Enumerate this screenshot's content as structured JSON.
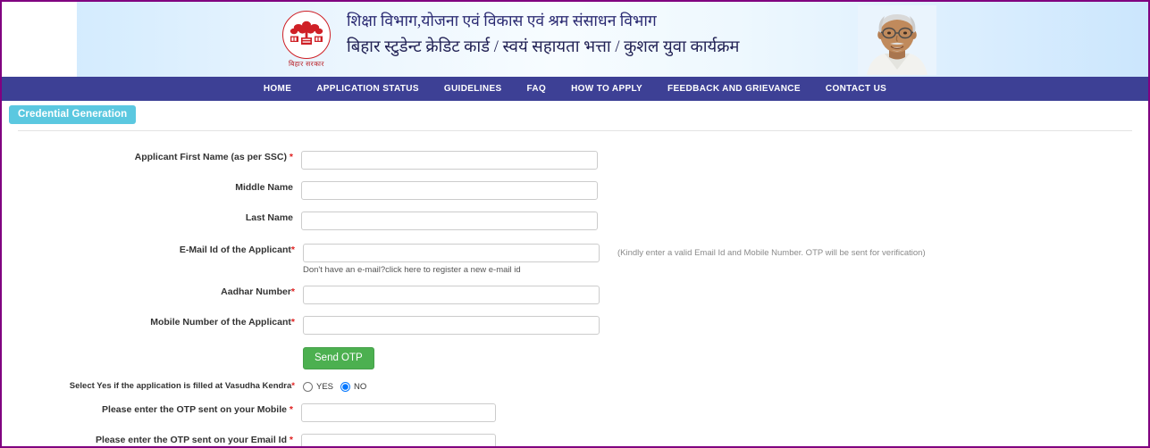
{
  "header": {
    "emblem_name": "bihar-government-emblem",
    "emblem_caption": "बिहार सरकार",
    "title_line1": "शिक्षा विभाग,योजना एवं विकास एवं श्रम संसाधन विभाग",
    "title_line2": "बिहार स्टुडेन्ट क्रेडिट कार्ड / स्वयं सहायता भत्ता / कुशल युवा कार्यक्रम",
    "portrait_name": "chief-minister-portrait"
  },
  "nav": {
    "items": [
      {
        "label": "HOME"
      },
      {
        "label": "APPLICATION STATUS"
      },
      {
        "label": "GUIDELINES"
      },
      {
        "label": "FAQ"
      },
      {
        "label": "HOW TO APPLY"
      },
      {
        "label": "FEEDBACK AND GRIEVANCE"
      },
      {
        "label": "CONTACT US"
      }
    ]
  },
  "tab": {
    "active_label": "Credential Generation"
  },
  "form": {
    "first_name": {
      "label": "Applicant First Name (as per SSC)",
      "required": true,
      "value": "",
      "placeholder": ""
    },
    "middle_name": {
      "label": "Middle Name",
      "required": false,
      "value": "",
      "placeholder": ""
    },
    "last_name": {
      "label": "Last Name",
      "required": false,
      "value": "",
      "placeholder": ""
    },
    "email": {
      "label": "E-Mail Id of the Applicant",
      "required": true,
      "value": "",
      "placeholder": "",
      "hint": "Don't have an e-mail?click here to register a new e-mail id",
      "side_note": "(Kindly enter a valid Email Id and Mobile Number. OTP will be sent for verification)"
    },
    "aadhar": {
      "label": "Aadhar Number",
      "required": true,
      "value": "",
      "placeholder": ""
    },
    "mobile": {
      "label": "Mobile Number of the Applicant",
      "required": true,
      "value": "",
      "placeholder": ""
    },
    "send_otp_button": "Send OTP",
    "vasudha": {
      "label": "Select Yes if the application is filled at Vasudha Kendra",
      "required": true,
      "option_yes": "YES",
      "option_no": "NO",
      "selected": "NO"
    },
    "otp_mobile": {
      "label": "Please enter the OTP sent on your Mobile",
      "required": true,
      "value": "",
      "placeholder": ""
    },
    "otp_email": {
      "label": "Please enter the OTP sent on your Email Id",
      "required": true,
      "value": "",
      "placeholder": ""
    }
  },
  "colors": {
    "nav_bg": "#3d4095",
    "tab_bg": "#5bc8e0",
    "button_green": "#4cb050",
    "required_red": "#e02020",
    "page_border": "#800080",
    "emblem_red": "#cf2026"
  }
}
